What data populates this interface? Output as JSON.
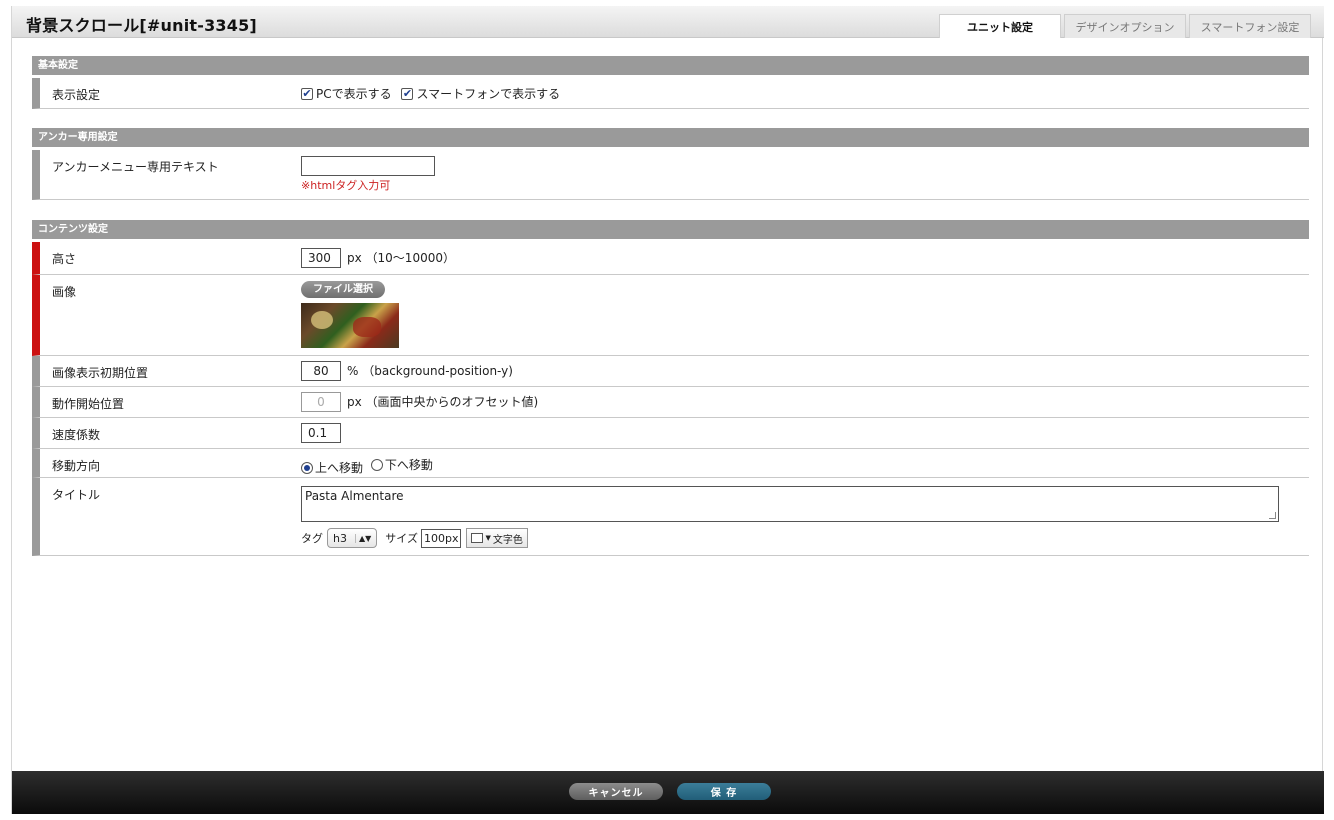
{
  "header": {
    "title": "背景スクロール[#unit-3345]",
    "tabs": [
      {
        "label": "ユニット設定",
        "active": true
      },
      {
        "label": "デザインオプション",
        "active": false
      },
      {
        "label": "スマートフォン設定",
        "active": false
      }
    ]
  },
  "basic": {
    "section_title": "基本設定",
    "display_label": "表示設定",
    "pc_label": "PCで表示する",
    "pc_checked": true,
    "sp_label": "スマートフォンで表示する",
    "sp_checked": true
  },
  "anchor": {
    "section_title": "アンカー専用設定",
    "text_label": "アンカーメニュー専用テキスト",
    "text_value": "",
    "hint": "※htmlタグ入力可"
  },
  "content": {
    "section_title": "コンテンツ設定",
    "height_label": "高さ",
    "height_value": "300",
    "height_unit": "px （10〜10000）",
    "image_label": "画像",
    "file_button": "ファイル選択",
    "image_pos_label": "画像表示初期位置",
    "image_pos_value": "80",
    "image_pos_unit": "% （background-position-y)",
    "start_pos_label": "動作開始位置",
    "start_pos_value": "0",
    "start_pos_unit": "px （画面中央からのオフセット値)",
    "speed_label": "速度係数",
    "speed_value": "0.1",
    "direction_label": "移動方向",
    "direction_up": "上へ移動",
    "direction_down": "下へ移動",
    "direction_selected": "up",
    "title_label": "タイトル",
    "title_value": "Pasta Almentare",
    "tag_label": "タグ",
    "tag_value": "h3",
    "size_label": "サイズ",
    "size_value": "100px",
    "color_button": "文字色"
  },
  "footer": {
    "cancel_label": "キャンセル",
    "save_label": "保 存"
  },
  "colors": {
    "required_marker": "#cc1111",
    "section_bar": "#9a9a9a",
    "save_button": "#2a6c88",
    "hint_text": "#cc2222"
  }
}
